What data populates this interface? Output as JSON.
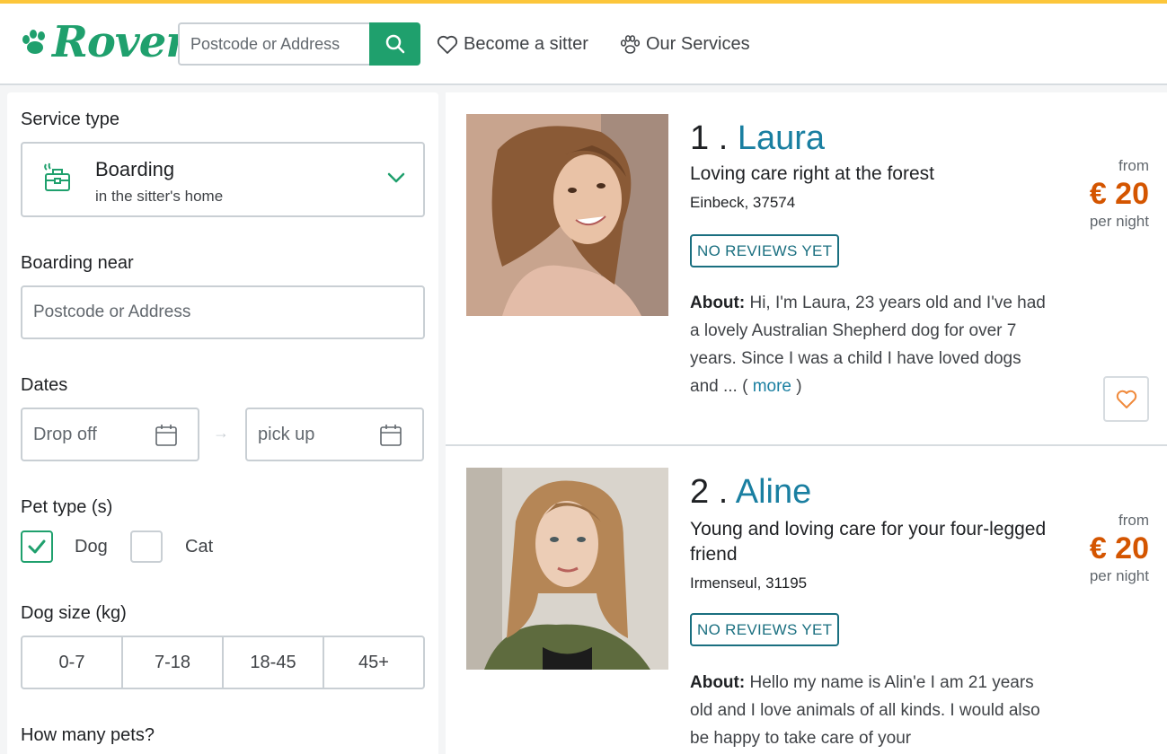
{
  "brand": {
    "logo_text": "Rover",
    "accent": "#1fa06d",
    "stripe": "#fcc63a"
  },
  "header": {
    "search_placeholder": "Postcode or Address",
    "nav": [
      {
        "label": "Become a sitter",
        "icon": "heart-outline-icon"
      },
      {
        "label": "Our Services",
        "icon": "paw-icon"
      }
    ]
  },
  "filters": {
    "service_type_label": "Service type",
    "service": {
      "name": "Boarding",
      "sub": "in the sitter's home",
      "icon": "boarding-suitcase-icon"
    },
    "near_label": "Boarding near",
    "near_placeholder": "Postcode or Address",
    "dates_label": "Dates",
    "drop_off": "Drop off",
    "pick_up": "pick up",
    "date_arrow": "→",
    "pet_type_label": "Pet type (s)",
    "pets": [
      {
        "label": "Dog",
        "checked": true
      },
      {
        "label": "Cat",
        "checked": false
      }
    ],
    "dog_size_label": "Dog size (kg)",
    "sizes": [
      "0-7",
      "7-18",
      "18-45",
      "45+"
    ],
    "how_many_label": "How many pets?"
  },
  "results": [
    {
      "rank": "1 . ",
      "name": "Laura",
      "headline": "Loving care right at the forest",
      "location": "Einbeck, 37574",
      "badge": "NO REVIEWS YET",
      "about_label": "About:",
      "about_text": " Hi, I'm Laura, 23 years old and I've had a lovely Australian Shepherd dog for over 7 years. Since I was a child I have loved dogs and ... ( ",
      "more": "more",
      "about_close": " )",
      "price_from": "from",
      "price": "€ 20",
      "price_unit": "per night"
    },
    {
      "rank": "2 . ",
      "name": "Aline",
      "headline": "Young and loving care for your four-legged friend",
      "location": "Irmenseul, 31195",
      "badge": "NO REVIEWS YET",
      "about_label": "About:",
      "about_text": " Hello my name is Alin'e I am 21 years old and I love animals of all kinds. I would also be happy to take care of your",
      "price_from": "from",
      "price": "€ 20",
      "price_unit": "per night"
    }
  ]
}
